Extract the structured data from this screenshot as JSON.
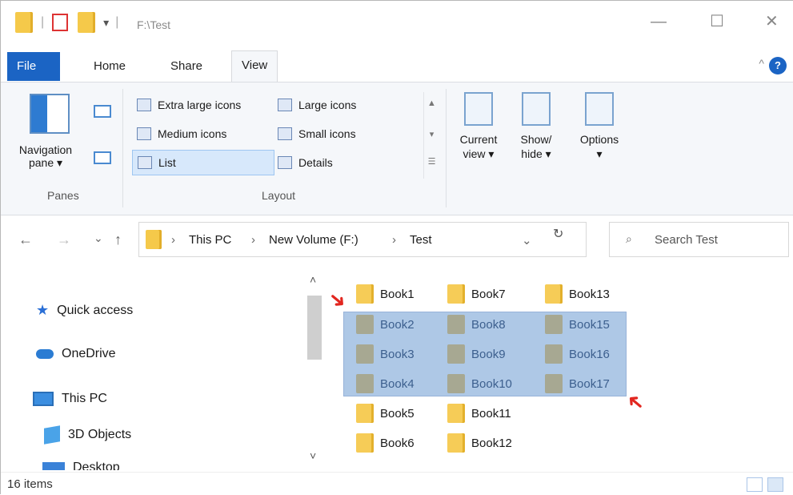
{
  "window": {
    "title": "F:\\Test",
    "controls": {
      "minimize": "—",
      "maximize": "☐",
      "close": "✕"
    }
  },
  "quick_access": {
    "dropdown": "▾",
    "separator": "|"
  },
  "tabs": [
    {
      "label": "File"
    },
    {
      "label": "Home"
    },
    {
      "label": "Share"
    },
    {
      "label": "View"
    }
  ],
  "ribbon": {
    "help": "?",
    "collapse": "^",
    "panes": {
      "navigation_pane_line1": "Navigation",
      "navigation_pane_line2": "pane ▾",
      "group_label": "Panes"
    },
    "layout": {
      "items": [
        {
          "label": "Extra large icons"
        },
        {
          "label": "Large icons"
        },
        {
          "label": "Medium icons"
        },
        {
          "label": "Small icons"
        },
        {
          "label": "List"
        },
        {
          "label": "Details"
        }
      ],
      "group_label": "Layout",
      "scroll_up": "▲",
      "scroll_down": "▾",
      "expand": "☰"
    },
    "current_view": {
      "line1": "Current",
      "line2": "view ▾"
    },
    "show_hide": {
      "line1": "Show/",
      "line2": "hide ▾"
    },
    "options": {
      "line1": "Options",
      "line2": "▾"
    }
  },
  "address": {
    "back": "←",
    "forward": "→",
    "recent": "⌄",
    "up": "↑",
    "crumbs": [
      "This PC",
      "New Volume (F:)",
      "Test"
    ],
    "crumb_sep": "›",
    "dropdown": "⌄",
    "refresh": "↻",
    "search_icon": "⌕",
    "search_placeholder": "Search Test"
  },
  "nav_pane": {
    "items": [
      {
        "label": "Quick access",
        "icon": "star-icon"
      },
      {
        "label": "OneDrive",
        "icon": "cloud-icon"
      },
      {
        "label": "This PC",
        "icon": "monitor-icon"
      },
      {
        "label": "3D Objects",
        "icon": "cube-icon"
      },
      {
        "label": "Desktop",
        "icon": "desktop-icon"
      }
    ],
    "scroll_up": "˄",
    "scroll_down": "˅"
  },
  "files": [
    {
      "name": "Book1",
      "selected": false
    },
    {
      "name": "Book2",
      "selected": true
    },
    {
      "name": "Book3",
      "selected": true
    },
    {
      "name": "Book4",
      "selected": true
    },
    {
      "name": "Book5",
      "selected": false
    },
    {
      "name": "Book6",
      "selected": false
    },
    {
      "name": "Book7",
      "selected": false
    },
    {
      "name": "Book8",
      "selected": true
    },
    {
      "name": "Book9",
      "selected": true
    },
    {
      "name": "Book10",
      "selected": true
    },
    {
      "name": "Book11",
      "selected": false
    },
    {
      "name": "Book12",
      "selected": false
    },
    {
      "name": "Book13",
      "selected": false
    },
    {
      "name": "Book15",
      "selected": true
    },
    {
      "name": "Book16",
      "selected": true
    },
    {
      "name": "Book17",
      "selected": true
    }
  ],
  "status": {
    "item_count": "16 items"
  },
  "colors": {
    "accent": "#1b64c4",
    "selection": "#7ea7d8",
    "annotation_arrow": "#e2261f",
    "folder": "#f6cc57"
  }
}
